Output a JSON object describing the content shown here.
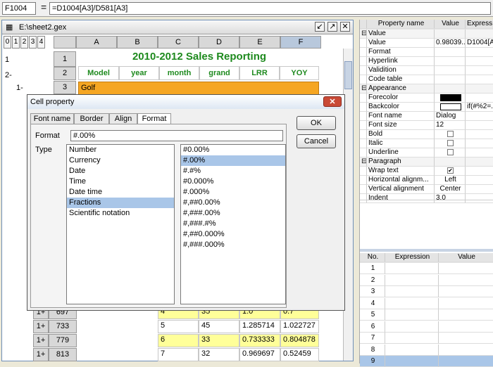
{
  "formula_bar": {
    "cell_ref": "F1004",
    "equals": "=",
    "formula": "=D1004[A3]/D581[A3]"
  },
  "inner_window": {
    "title": "E:\\sheet2.gex",
    "levels": [
      "0",
      "1",
      "2",
      "3",
      "4"
    ],
    "columns": [
      "A",
      "B",
      "C",
      "D",
      "E",
      "F"
    ],
    "outline_labels": [
      "1",
      "2-",
      "1-"
    ],
    "sheet_title": "2010-2012 Sales Reporting",
    "headers": [
      "Model",
      "year",
      "month",
      "grand",
      "LRR",
      "YOY"
    ],
    "rows_top": [
      "1",
      "2",
      "3"
    ],
    "golf": "Golf"
  },
  "dialog": {
    "title": "Cell property",
    "tabs": [
      "Font name",
      "Border",
      "Align",
      "Format"
    ],
    "format_label": "Format",
    "format_value": "#.00%",
    "type_label": "Type",
    "types": [
      "Number",
      "Currency",
      "Date",
      "Time",
      "Date time",
      "Fractions",
      "Scientific notation"
    ],
    "selected_type": "Fractions",
    "formats": [
      "#0.00%",
      "#.00%",
      "#.#%",
      "#0.000%",
      "#.000%",
      "#,##0.00%",
      "#,###.00%",
      "#,###.#%",
      "#,##0.000%",
      "#,###.000%"
    ],
    "selected_format": "#.00%",
    "ok": "OK",
    "cancel": "Cancel"
  },
  "bottom_rows": [
    {
      "lvl": "1+",
      "num": "697",
      "d": "4",
      "e": "35",
      "f": "1.0",
      "g": "0.7",
      "hl": true
    },
    {
      "lvl": "1+",
      "num": "733",
      "d": "5",
      "e": "45",
      "f": "1.285714",
      "g": "1.022727",
      "hl": false
    },
    {
      "lvl": "1+",
      "num": "779",
      "d": "6",
      "e": "33",
      "f": "0.733333",
      "g": "0.804878",
      "hl": true
    },
    {
      "lvl": "1+",
      "num": "813",
      "d": "7",
      "e": "32",
      "f": "0.969697",
      "g": "0.52459",
      "hl": false
    }
  ],
  "properties": {
    "headers": [
      "Property name",
      "Value",
      "Express"
    ],
    "rows": [
      {
        "name": "Value",
        "value": "",
        "expr": "",
        "group": true
      },
      {
        "name": "Value",
        "value": "0.98039...",
        "expr": "D1004[A3]"
      },
      {
        "name": "Format",
        "value": "",
        "expr": ""
      },
      {
        "name": "Hyperlink",
        "value": "",
        "expr": ""
      },
      {
        "name": "Validition",
        "value": "",
        "expr": ""
      },
      {
        "name": "Code table",
        "value": "",
        "expr": ""
      },
      {
        "name": "Appearance",
        "value": "",
        "expr": "",
        "group": true
      },
      {
        "name": "Forecolor",
        "value": "",
        "expr": "",
        "swatch": "#000000"
      },
      {
        "name": "Backcolor",
        "value": "",
        "expr": "if(#%2=...",
        "swatch": "#ffffff"
      },
      {
        "name": "Font name",
        "value": "Dialog",
        "expr": ""
      },
      {
        "name": "Font size",
        "value": "12",
        "expr": ""
      },
      {
        "name": "Bold",
        "value": "",
        "expr": "",
        "chk": true
      },
      {
        "name": "Italic",
        "value": "",
        "expr": "",
        "chk": true
      },
      {
        "name": "Underline",
        "value": "",
        "expr": "",
        "chk": true
      },
      {
        "name": "Paragraph",
        "value": "",
        "expr": "",
        "group": true
      },
      {
        "name": "Wrap text",
        "value": "✔",
        "expr": "",
        "chk": true
      },
      {
        "name": "Horizontal alignm...",
        "value": "Left",
        "expr": ""
      },
      {
        "name": "Vertical alignment",
        "value": "Center",
        "expr": ""
      },
      {
        "name": "Indent",
        "value": "3.0",
        "expr": ""
      }
    ]
  },
  "expr_table": {
    "headers": [
      "No.",
      "Expression",
      "Value"
    ],
    "rows": [
      "1",
      "2",
      "3",
      "4",
      "5",
      "6",
      "7",
      "8",
      "9"
    ]
  }
}
